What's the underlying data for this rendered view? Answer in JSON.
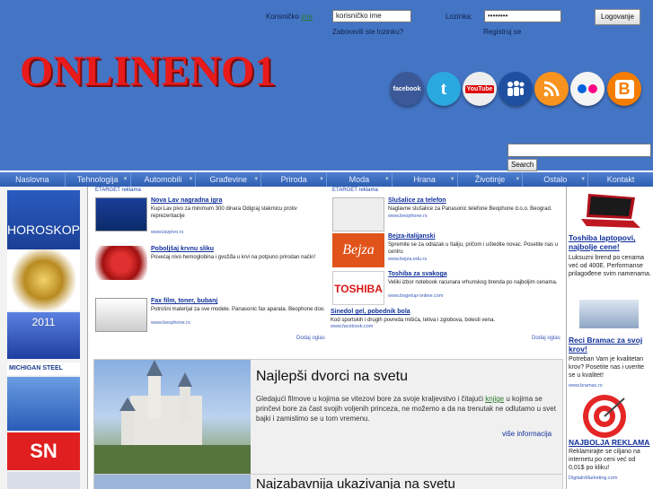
{
  "login": {
    "username_label_pre": "Korisničko ",
    "username_label_hl": "ime",
    "username_value": "korisničko ime",
    "password_label": "Lozinka:",
    "password_value": "••••••••",
    "login_button": "Logovanje",
    "forgot_link": "Zaboravili ste lozinku?",
    "register_link": "Registruj se"
  },
  "logo": "ONLINENO1",
  "social": [
    {
      "name": "facebook-icon",
      "label": "facebook",
      "color": "#3b5998"
    },
    {
      "name": "twitter-icon",
      "label": "t",
      "color": "#2aa9e0"
    },
    {
      "name": "youtube-icon",
      "label": "YouTube",
      "color": "#e8e8e8"
    },
    {
      "name": "myspace-icon",
      "label": "",
      "color": "#1e4fa0"
    },
    {
      "name": "rss-icon",
      "label": "",
      "color": "#f7931e"
    },
    {
      "name": "flickr-icon",
      "label": "",
      "color": "#f0f0f0"
    },
    {
      "name": "blogger-icon",
      "label": "B",
      "color": "#f57d00"
    }
  ],
  "search": {
    "button": "Search"
  },
  "nav": [
    "Naslovna",
    "Tehnologija",
    "Automobili",
    "Građevine",
    "Priroda",
    "Moda",
    "Hrana",
    "Životinje",
    "Ostalo",
    "Kontakt"
  ],
  "left_banners": [
    "HOROSKOP",
    "2011",
    "MICHIGAN STEEL",
    "SN"
  ],
  "ads_left": {
    "header": "ETARGET reklama",
    "dodaj": "Dodaj oglas",
    "items": [
      {
        "title": "Nova Lav nagradna igra",
        "desc": "Kupi Lav pivo za minimum 300 dinara Odigraj stakmicu protiv reprezentacije",
        "url": "www.lavpivo.rs"
      },
      {
        "title": "Poboljšaj krvnu sliku",
        "desc": "Povećaj nivo hemoglobina i gvožđa u krvi na potpuno prirodan način!",
        "url": "www.primama-medicina.com"
      },
      {
        "title": "Fax film, toner, bubanj",
        "desc": "Potrošni materijal za sve modele. Panasonic fax aparata. Beophone doo.",
        "url": "www.beophone.rs"
      }
    ]
  },
  "ads_right": {
    "header": "ETARGET reklama",
    "dodaj": "Dodaj oglas",
    "items": [
      {
        "title": "Slušalice za telefon",
        "desc": "Naglavne slušalice za Panasonic telefone Beophone d.o.o. Beograd.",
        "url": "www.beophone.rs"
      },
      {
        "title": "Bejza-italijanski",
        "desc": "Spremite se za odlazak u Italiju, pričom i uštedite novac. Posetite nas u centru",
        "url": "www.bejza.edu.rs"
      },
      {
        "title": "Toshiba za svakoga",
        "desc": "Veliki izbor notebook racunara vrhunskog brenda po najboljim cenama.",
        "url": "www.bogetup-online.com"
      },
      {
        "title": "Sinedol gel, pobednik bola",
        "desc": "Kod sportskih i drugih povreda mišića, tetiva i zglobova, bolesti vena.",
        "url": "www.facebook.com"
      }
    ]
  },
  "article": {
    "title": "Najlepši dvorci na svetu",
    "text_pre": "Gledajući filmove u kojima se vitezovi bore za svoje kraljevstvo i čitajući ",
    "text_hl": "knjige",
    "text_post": " u kojima se prinčevi bore za čast svojih voljenih princeza, ne možemo a da na trenutak ne odlutamo u svet bajki i zamislimo se u tom vremenu.",
    "more": "više informacija"
  },
  "article2": {
    "title": "Najzabavnija ukazivanja na svetu"
  },
  "right_ads": [
    {
      "title": "Toshiba laptopovi, najbolje cene!",
      "desc": "Luksuzni brend po cenama već od 400E. Performanse prilagođene svim namenama.",
      "url": ""
    },
    {
      "title": "Reci Bramac za svoj krov!",
      "desc": "Potreban Vam je kvalitetan krov? Posetite nas i uverite se u kvalitet!",
      "url": "www.bramac.rs"
    },
    {
      "title": "NAJBOLJA REKLAMA",
      "desc": "Reklamirajte se ciljano na internetu po ceni već od 0,01$ po kliku!",
      "url": "DigitalnMarketing.com"
    }
  ]
}
